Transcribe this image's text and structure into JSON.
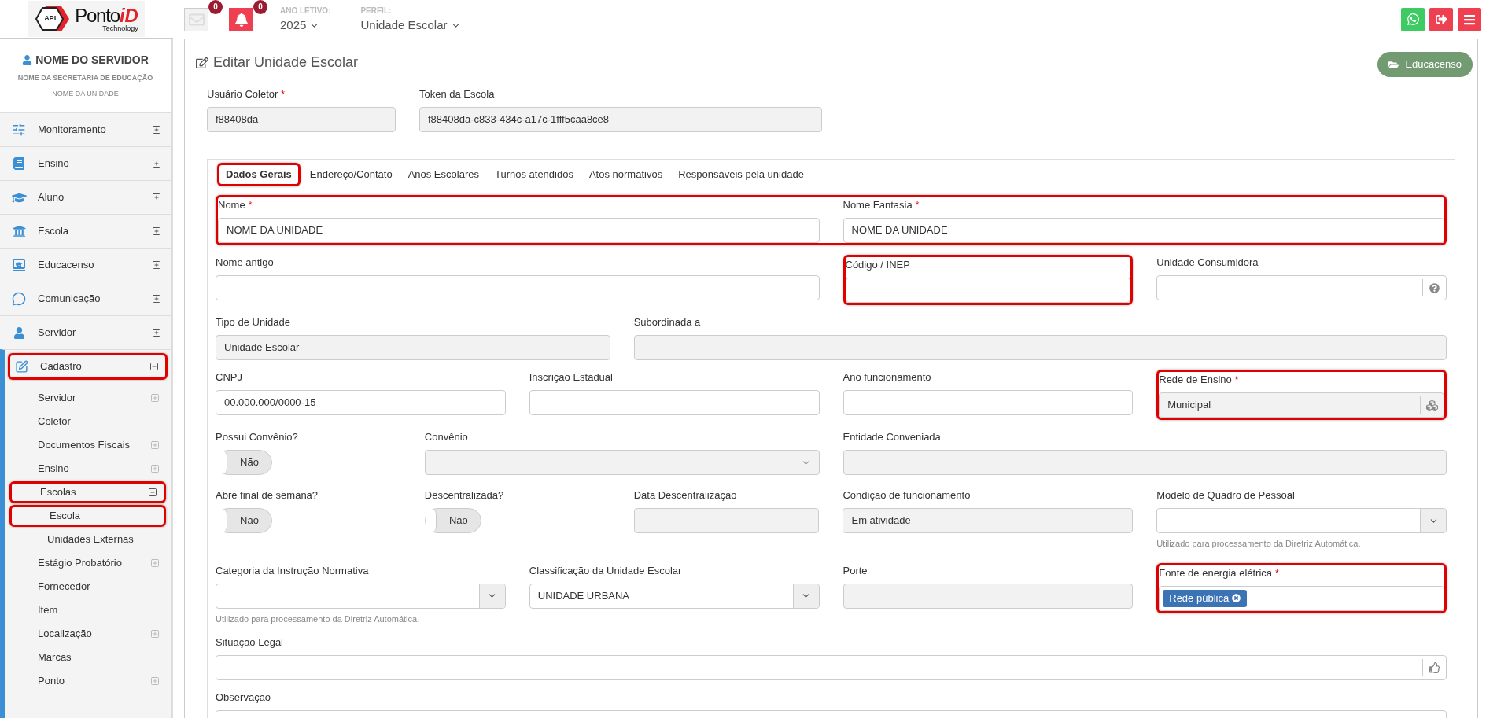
{
  "header": {
    "logo": {
      "badge": "API",
      "name": "Ponto",
      "accent": "iD",
      "tagline": "Technology"
    },
    "messages_count": "0",
    "notifications_count": "0",
    "year": {
      "label": "ANO LETIVO:",
      "value": "2025"
    },
    "profile": {
      "label": "PERFIL:",
      "value": "Unidade Escolar"
    }
  },
  "user": {
    "name": "NOME DO SERVIDOR",
    "department": "NOME DA SECRETARIA DE EDUCAÇÃO",
    "unit": "NOME DA UNIDADE"
  },
  "sidebar": {
    "items": [
      {
        "label": "Monitoramento",
        "expanded": false,
        "highlighted": false
      },
      {
        "label": "Ensino",
        "expanded": false,
        "highlighted": false
      },
      {
        "label": "Aluno",
        "expanded": false,
        "highlighted": false
      },
      {
        "label": "Escola",
        "expanded": false,
        "highlighted": false
      },
      {
        "label": "Educacenso",
        "expanded": false,
        "highlighted": false
      },
      {
        "label": "Comunicação",
        "expanded": false,
        "highlighted": false
      },
      {
        "label": "Servidor",
        "expanded": false,
        "highlighted": false
      },
      {
        "label": "Cadastro",
        "expanded": true,
        "highlighted": true,
        "children": [
          {
            "label": "Servidor",
            "expanded": false,
            "highlighted": false
          },
          {
            "label": "Coletor",
            "highlighted": false
          },
          {
            "label": "Documentos Fiscais",
            "expanded": false,
            "highlighted": false
          },
          {
            "label": "Ensino",
            "expanded": false,
            "highlighted": false
          },
          {
            "label": "Escolas",
            "expanded": true,
            "highlighted": true,
            "children": [
              {
                "label": "Escola",
                "highlighted": true
              },
              {
                "label": "Unidades Externas",
                "highlighted": false
              }
            ]
          },
          {
            "label": "Estágio Probatório",
            "expanded": false,
            "highlighted": false
          },
          {
            "label": "Fornecedor",
            "highlighted": false
          },
          {
            "label": "Item",
            "highlighted": false
          },
          {
            "label": "Localização",
            "expanded": false,
            "highlighted": false
          },
          {
            "label": "Marcas",
            "highlighted": false
          },
          {
            "label": "Ponto",
            "expanded": false,
            "highlighted": false
          }
        ]
      }
    ]
  },
  "page": {
    "title": "Editar Unidade Escolar",
    "action": "Educacenso"
  },
  "collector": [
    {
      "label": "Usuário Coletor",
      "required_mark": "*",
      "disabled": true,
      "value": "f88408da"
    },
    {
      "label": "Token da Escola",
      "disabled": true,
      "value": "f88408da-c833-434c-a17c-1fff5caa8ce8"
    }
  ],
  "tabs": [
    {
      "label": "Dados Gerais",
      "selected": true,
      "highlighted": true
    },
    {
      "label": "Endereço/Contato",
      "selected": false,
      "highlighted": false
    },
    {
      "label": "Anos Escolares",
      "selected": false,
      "highlighted": false
    },
    {
      "label": "Turnos atendidos",
      "selected": false,
      "highlighted": false
    },
    {
      "label": "Atos normativos",
      "selected": false,
      "highlighted": false
    },
    {
      "label": "Responsáveis pela unidade",
      "selected": false,
      "highlighted": false
    }
  ],
  "form_rows": [
    {
      "highlighted": true,
      "fields": [
        {
          "kind": "text",
          "label": "Nome",
          "required_mark": "*",
          "disabled": false,
          "highlighted": false,
          "value": "NOME DA UNIDADE"
        },
        {
          "kind": "text",
          "label": "Nome Fantasia",
          "required_mark": "*",
          "disabled": false,
          "highlighted": false,
          "value": "NOME DA UNIDADE"
        }
      ]
    },
    {
      "highlighted": false,
      "fields": [
        {
          "kind": "text",
          "label": "Nome antigo",
          "disabled": false,
          "highlighted": false
        },
        {
          "kind": "text",
          "label": "Código / INEP",
          "disabled": false,
          "highlighted": true
        },
        {
          "kind": "addon",
          "label": "Unidade Consumidora",
          "disabled": false,
          "highlighted": false
        }
      ]
    },
    {
      "highlighted": false,
      "fields": [
        {
          "kind": "text",
          "label": "Tipo de Unidade",
          "disabled": true,
          "highlighted": false,
          "value": "Unidade Escolar"
        },
        {
          "kind": "text",
          "label": "Subordinada a",
          "disabled": true,
          "highlighted": false
        }
      ]
    },
    {
      "highlighted": false,
      "fields": [
        {
          "kind": "text",
          "label": "CNPJ",
          "disabled": false,
          "highlighted": false,
          "value": "00.000.000/0000-15"
        },
        {
          "kind": "text",
          "label": "Inscrição Estadual",
          "disabled": false,
          "highlighted": false
        },
        {
          "kind": "text",
          "label": "Ano funcionamento",
          "disabled": false,
          "highlighted": false
        },
        {
          "kind": "addon",
          "label": "Rede de Ensino",
          "required_mark": "*",
          "disabled": true,
          "highlighted": true,
          "value": "Municipal"
        }
      ]
    },
    {
      "highlighted": false,
      "fields": [
        {
          "kind": "toggle",
          "label": "Possui Convênio?",
          "on": false,
          "highlighted": false,
          "value": "Não"
        },
        {
          "kind": "select",
          "label": "Convênio",
          "disabled": true,
          "highlighted": false
        },
        {
          "kind": "text",
          "label": "Entidade Conveniada",
          "disabled": true,
          "highlighted": false
        }
      ]
    },
    {
      "highlighted": false,
      "fields": [
        {
          "kind": "toggle",
          "label": "Abre final de semana?",
          "on": false,
          "highlighted": false,
          "value": "Não"
        },
        {
          "kind": "toggle",
          "label": "Descentralizada?",
          "on": false,
          "highlighted": false,
          "value": "Não"
        },
        {
          "kind": "text",
          "label": "Data Descentralização",
          "disabled": true,
          "highlighted": false
        },
        {
          "kind": "text",
          "label": "Condição de funcionamento",
          "disabled": true,
          "highlighted": false,
          "value": "Em atividade"
        },
        {
          "kind": "select",
          "label": "Modelo de Quadro de Pessoal",
          "disabled": false,
          "highlighted": false,
          "hint": "Utilizado para processamento da Diretriz Automática."
        }
      ]
    },
    {
      "highlighted": false,
      "fields": [
        {
          "kind": "select",
          "label": "Categoria da Instrução Normativa",
          "disabled": false,
          "highlighted": false,
          "hint": "Utilizado para processamento da Diretriz Automática."
        },
        {
          "kind": "select",
          "label": "Classificação da Unidade Escolar",
          "disabled": false,
          "highlighted": false,
          "value": "UNIDADE URBANA"
        },
        {
          "kind": "text",
          "label": "Porte",
          "disabled": true,
          "highlighted": false
        },
        {
          "kind": "tags",
          "label": "Fonte de energia elétrica",
          "required_mark": "*",
          "highlighted": true,
          "tags": [
            "Rede pública"
          ]
        }
      ]
    },
    {
      "highlighted": false,
      "fields": [
        {
          "kind": "addon",
          "label": "Situação Legal",
          "disabled": false,
          "highlighted": false
        }
      ]
    },
    {
      "highlighted": false,
      "fields": [
        {
          "kind": "textarea",
          "label": "Observação",
          "highlighted": false
        }
      ]
    }
  ]
}
